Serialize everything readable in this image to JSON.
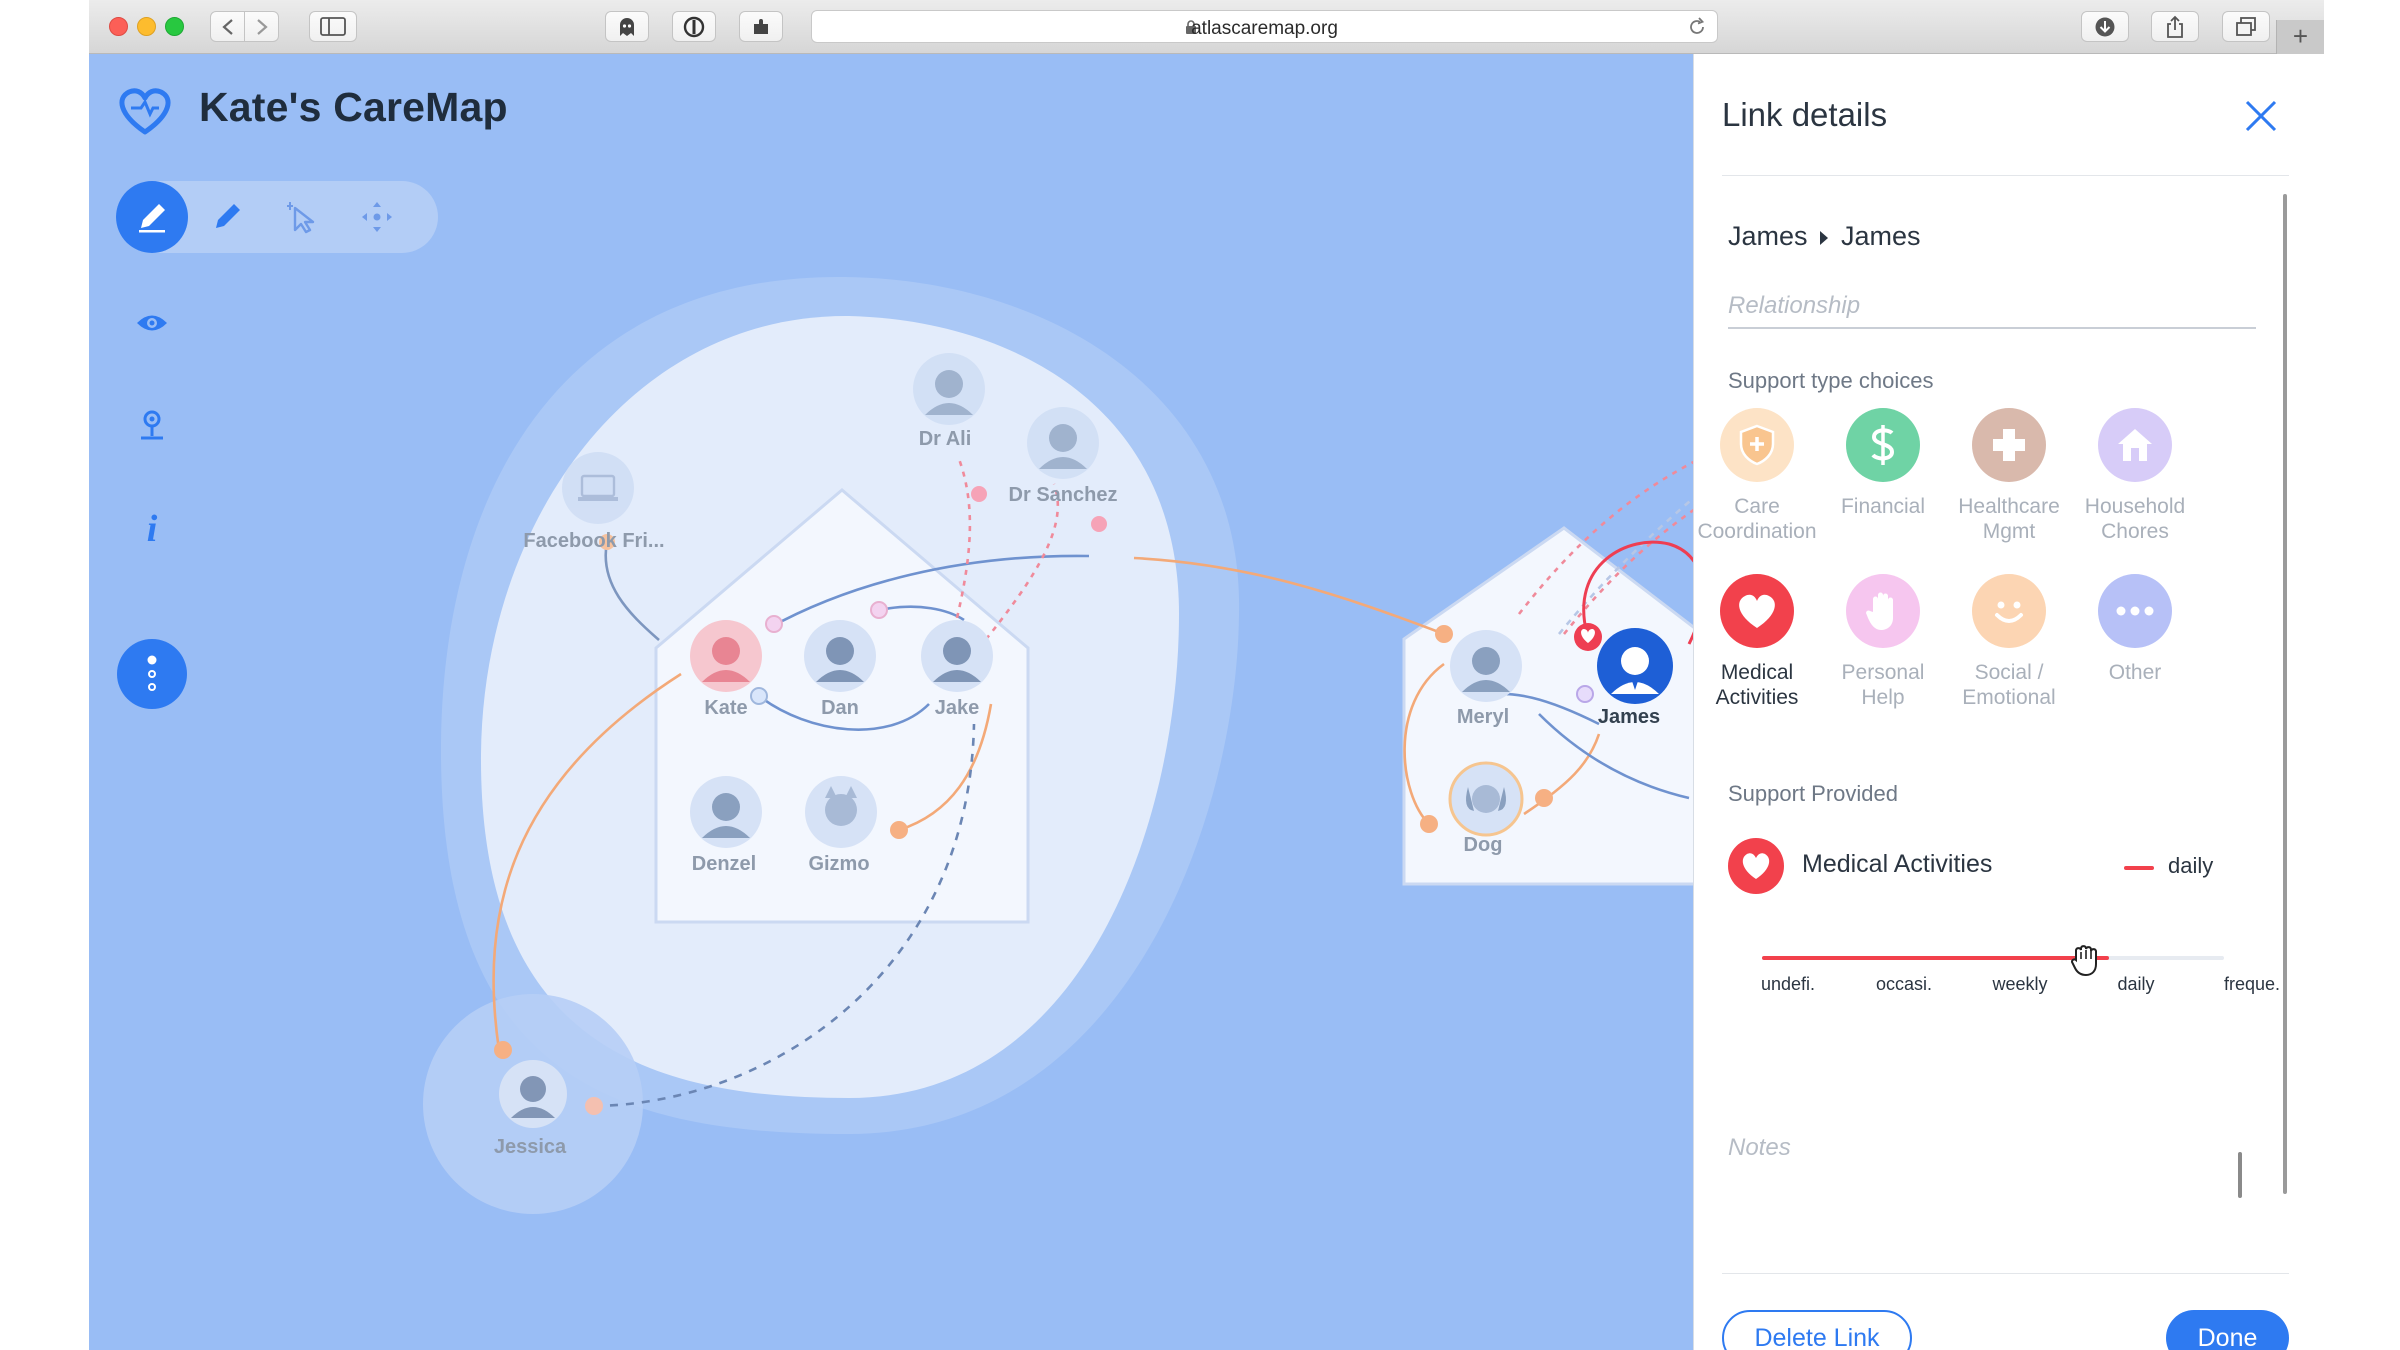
{
  "browser": {
    "url": "atlascaremap.org",
    "icons": [
      "back-icon",
      "forward-icon",
      "sidebar-icon",
      "ghost-icon",
      "shield-icon",
      "puzzle-icon",
      "lock-icon",
      "reload-icon",
      "download-icon",
      "share-icon",
      "tabs-icon",
      "new-tab-icon"
    ],
    "new_tab_label": "+"
  },
  "app": {
    "title": "Kate's CareMap",
    "logo_icon": "heart-outline-icon",
    "tools": [
      "edit-icon",
      "pencil-icon",
      "select-icon",
      "move-icon"
    ],
    "side_icons": [
      "eye-icon",
      "location-pin-icon",
      "info-icon",
      "more-options-icon"
    ],
    "info_glyph": "i"
  },
  "map": {
    "nodes": [
      {
        "id": "kate",
        "label": "Kate"
      },
      {
        "id": "dan",
        "label": "Dan"
      },
      {
        "id": "jake",
        "label": "Jake"
      },
      {
        "id": "denzel",
        "label": "Denzel"
      },
      {
        "id": "gizmo",
        "label": "Gizmo"
      },
      {
        "id": "dr-ali",
        "label": "Dr Ali"
      },
      {
        "id": "dr-sanchez",
        "label": "Dr Sanchez"
      },
      {
        "id": "facebook",
        "label": "Facebook Fri..."
      },
      {
        "id": "jessica",
        "label": "Jessica"
      },
      {
        "id": "meryl",
        "label": "Meryl"
      },
      {
        "id": "james",
        "label": "James"
      },
      {
        "id": "dog",
        "label": "Dog"
      }
    ]
  },
  "panel": {
    "title": "Link details",
    "close_icon": "close-icon",
    "link_from": "James",
    "link_to": "James",
    "relationship_placeholder": "Relationship",
    "support_choices_label": "Support type choices",
    "support_types": [
      {
        "id": "care",
        "line1": "Care",
        "line2": "Coordination",
        "icon": "shield-plus-icon",
        "color": "#f9c58f",
        "active": false
      },
      {
        "id": "financial",
        "line1": "Financial",
        "line2": "",
        "icon": "dollar-icon",
        "color": "#5fcf9b",
        "active": false
      },
      {
        "id": "healthcare",
        "line1": "Healthcare",
        "line2": "Mgmt",
        "icon": "plus-cross-icon",
        "color": "#cfa99a",
        "active": false
      },
      {
        "id": "household",
        "line1": "Household",
        "line2": "Chores",
        "icon": "house-icon",
        "color": "#c9b9f6",
        "active": false
      },
      {
        "id": "medical",
        "line1": "Medical",
        "line2": "Activities",
        "icon": "heart-icon",
        "color": "#f2414c",
        "active": true
      },
      {
        "id": "personal",
        "line1": "Personal",
        "line2": "Help",
        "icon": "hand-icon",
        "color": "#f0a6e5",
        "active": false
      },
      {
        "id": "social",
        "line1": "Social /",
        "line2": "Emotional",
        "icon": "smile-icon",
        "color": "#f9c08c",
        "active": false
      },
      {
        "id": "other",
        "line1": "Other",
        "line2": "",
        "icon": "more-icon",
        "color": "#a8b4f5",
        "active": false
      }
    ],
    "support_provided_label": "Support Provided",
    "provided": {
      "name": "Medical Activities",
      "frequency": "daily",
      "icon": "heart-icon"
    },
    "frequency_ticks": [
      "undefi.",
      "occasi.",
      "weekly",
      "daily",
      "freque."
    ],
    "frequency_level": 0.75,
    "slider_handle_icon": "grab-hand-icon",
    "notes_placeholder": "Notes",
    "delete_label": "Delete Link",
    "done_label": "Done"
  }
}
